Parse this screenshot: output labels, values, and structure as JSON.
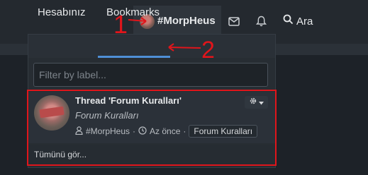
{
  "header": {
    "username": "#MorpHeus",
    "search_label": "Ara"
  },
  "menu": {
    "tabs": [
      {
        "label": "Hesabınız"
      },
      {
        "label": "Bookmarks"
      }
    ],
    "filter_placeholder": "Filter by label...",
    "bookmark": {
      "title": "Thread 'Forum Kuralları'",
      "forum": "Forum Kuralları",
      "author": "#MorpHeus",
      "time": "Az önce",
      "separator": "·",
      "tag": "Forum Kuralları"
    },
    "footer_link": "Tümünü gör..."
  },
  "annotations": {
    "label_1": "1",
    "label_2": "2",
    "color": "#e0151b"
  },
  "icons": [
    "user-avatar",
    "envelope-icon",
    "bell-icon",
    "search-icon",
    "user-icon",
    "clock-icon",
    "gear-icon",
    "caret-down-icon"
  ]
}
